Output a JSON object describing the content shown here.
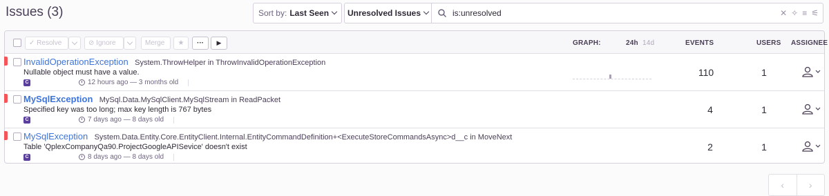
{
  "page": {
    "title": "Issues (3)"
  },
  "sort": {
    "label": "Sort by:",
    "value": "Last Seen"
  },
  "saved_search": {
    "label": "Unresolved Issues"
  },
  "search": {
    "value": "is:unresolved"
  },
  "toolbar": {
    "resolve": "Resolve",
    "ignore": "Ignore",
    "merge": "Merge",
    "more": "···",
    "play": "▶"
  },
  "columns": {
    "graph": "GRAPH:",
    "range_24h": "24h",
    "range_14d": "14d",
    "events": "EVENTS",
    "users": "USERS",
    "assignee": "ASSIGNEE"
  },
  "issues": [
    {
      "title": "InvalidOperationException",
      "culprit": "System.ThrowHelper in ThrowInvalidOperationException",
      "message": "Nullable object must have a value.",
      "time": "12 hours ago — 3 months old",
      "events": "110",
      "users": "1",
      "platform": "C#"
    },
    {
      "title": "MySqlException",
      "culprit": "MySql.Data.MySqlClient.MySqlStream in ReadPacket",
      "message": "Specified key was too long; max key length is 767 bytes",
      "time": "7 days ago — 8 days old",
      "events": "4",
      "users": "1",
      "platform": "C#"
    },
    {
      "title": "MySqlException",
      "culprit": "System.Data.Entity.Core.EntityClient.Internal.EntityCommandDefinition+<ExecuteStoreCommandsAsync>d__c in MoveNext",
      "message": "Table 'QplexCompanyQa90.ProjectGoogleAPISevice' doesn't exist",
      "time": "8 days ago — 8 days old",
      "events": "2",
      "users": "1",
      "platform": "C#"
    }
  ],
  "pager": {
    "prev": "‹",
    "next": "›"
  },
  "colors": {
    "accent": "#3d74db",
    "error": "#f55459",
    "platform": "#5a3e9e"
  }
}
